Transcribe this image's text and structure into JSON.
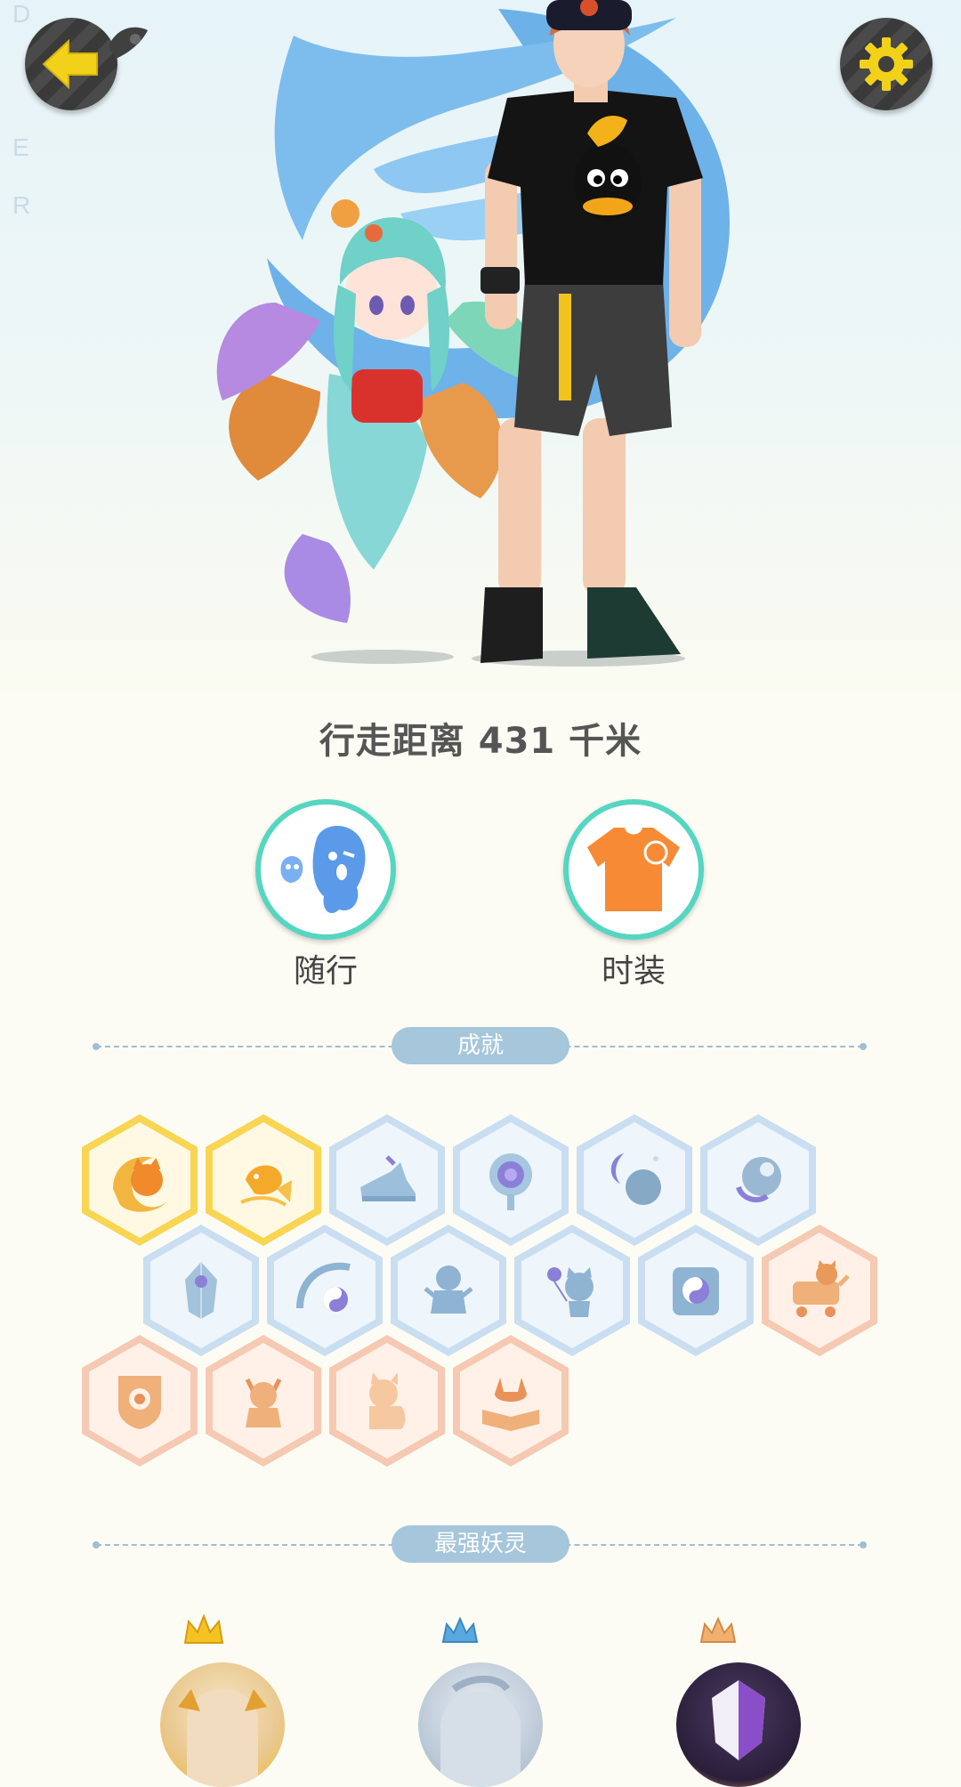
{
  "header": {
    "back_icon": "arrow-left-icon",
    "settings_icon": "gear-icon",
    "accent_yellow": "#f2d11a",
    "button_gray": "#404040",
    "watermark_letters": [
      "D",
      "E",
      "R"
    ]
  },
  "stats": {
    "distance_text": "行走距离 431 千米"
  },
  "actions": [
    {
      "label": "随行",
      "icon": "companion-spirit-icon"
    },
    {
      "label": "时装",
      "icon": "tshirt-icon"
    }
  ],
  "achievements": {
    "title": "成就",
    "badges": [
      {
        "icon": "cat-moon-badge-icon",
        "tier": "gold"
      },
      {
        "icon": "koi-fish-badge-icon",
        "tier": "gold"
      },
      {
        "icon": "sneaker-badge-icon",
        "tier": "blue"
      },
      {
        "icon": "portal-badge-icon",
        "tier": "blue"
      },
      {
        "icon": "moon-sphere-badge-icon",
        "tier": "blue"
      },
      {
        "icon": "crystal-ball-badge-icon",
        "tier": "blue"
      },
      {
        "icon": "crystal-badge-icon",
        "tier": "blue"
      },
      {
        "icon": "yin-yang-swirl-badge-icon",
        "tier": "blue"
      },
      {
        "icon": "spirit-figure-badge-icon",
        "tier": "blue"
      },
      {
        "icon": "cat-balloon-badge-icon",
        "tier": "blue"
      },
      {
        "icon": "yin-yang-book-badge-icon",
        "tier": "blue"
      },
      {
        "icon": "stroller-badge-icon",
        "tier": "peach"
      },
      {
        "icon": "shield-badge-icon",
        "tier": "peach"
      },
      {
        "icon": "ox-figure-badge-icon",
        "tier": "peach"
      },
      {
        "icon": "cat-silhouette-badge-icon",
        "tier": "peach"
      },
      {
        "icon": "fox-book-badge-icon",
        "tier": "peach"
      }
    ]
  },
  "strongest": {
    "title": "最强妖灵",
    "spirits": [
      {
        "icon": "spirit-avatar-1-icon",
        "crown": "gold-crown-icon"
      },
      {
        "icon": "spirit-avatar-2-icon",
        "crown": "silver-crown-icon"
      },
      {
        "icon": "spirit-avatar-3-icon",
        "crown": "bronze-crown-icon"
      }
    ]
  }
}
